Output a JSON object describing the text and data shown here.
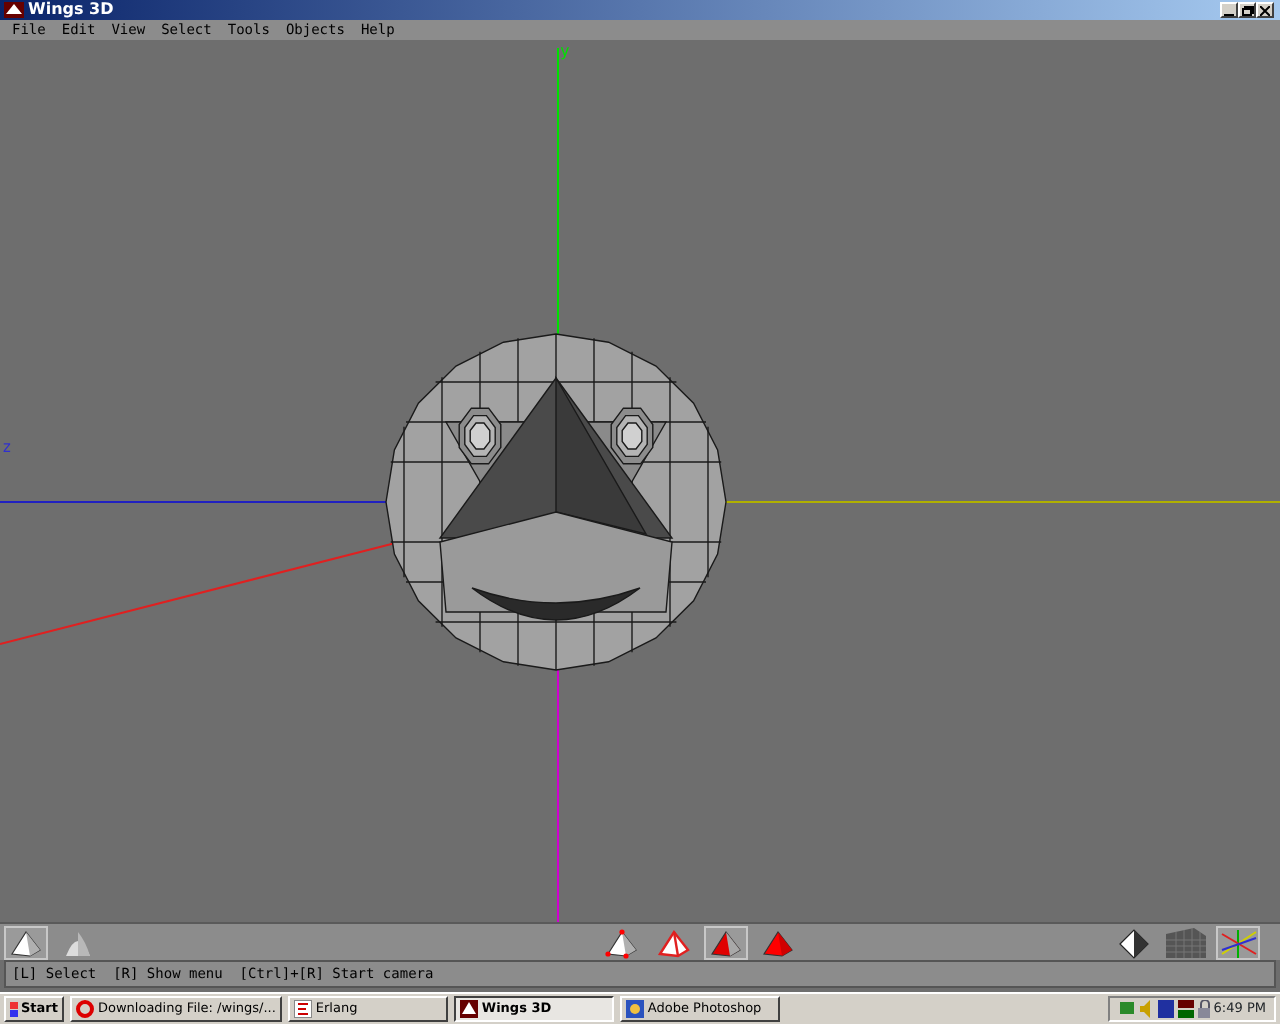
{
  "window": {
    "title": "Wings 3D"
  },
  "menu": [
    "File",
    "Edit",
    "View",
    "Select",
    "Tools",
    "Objects",
    "Help"
  ],
  "viewport": {
    "axis_labels": [
      {
        "kind": "y",
        "text": "y"
      },
      {
        "kind": "z",
        "text": "z"
      }
    ]
  },
  "toolbar": {
    "left": [
      {
        "kind": "flat",
        "selected": true
      },
      {
        "kind": "smooth",
        "selected": false
      }
    ],
    "select_modes": [
      {
        "kind": "vertex",
        "selected": false
      },
      {
        "kind": "edge",
        "selected": false
      },
      {
        "kind": "face",
        "selected": true
      },
      {
        "kind": "body",
        "selected": false
      }
    ],
    "right": [
      {
        "kind": "shaded",
        "selected": false
      },
      {
        "kind": "wire",
        "selected": false
      },
      {
        "kind": "axes",
        "selected": true
      }
    ]
  },
  "status_bar": "[L] Select  [R] Show menu  [Ctrl]+[R] Start camera",
  "taskbar": {
    "start": "Start",
    "tasks": [
      {
        "label": "Downloading File: /wings/...",
        "kind": "opera",
        "selected": false
      },
      {
        "label": "Erlang",
        "kind": "erlang",
        "selected": false
      },
      {
        "label": "Wings 3D",
        "kind": "wings",
        "selected": true
      },
      {
        "label": "Adobe Photoshop",
        "kind": "photoshop",
        "selected": false
      }
    ],
    "clock": "6:49 PM"
  }
}
